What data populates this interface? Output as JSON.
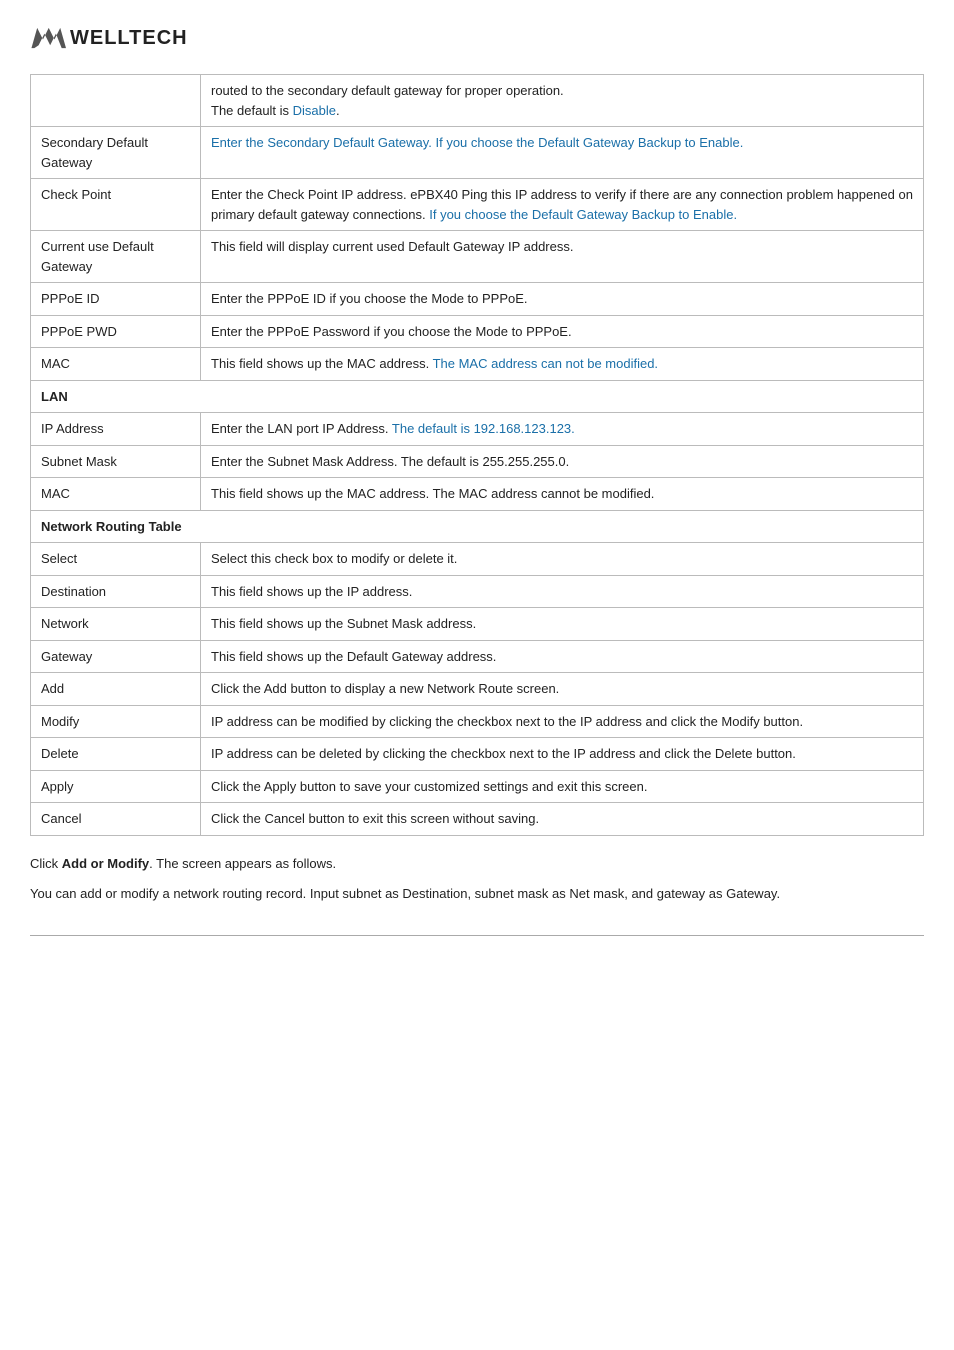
{
  "logo": {
    "text": "WELLTECH"
  },
  "table_rows": [
    {
      "id": "row-routed",
      "col1": "",
      "col2_parts": [
        {
          "text": "routed to the secondary default gateway for proper operation.",
          "blue": false
        },
        {
          "text": " The default is ",
          "blue": false
        },
        {
          "text": "Disable",
          "blue": true
        },
        {
          "text": ".",
          "blue": false
        }
      ]
    },
    {
      "id": "row-secondary-default-gateway",
      "col1": "Secondary Default Gateway",
      "col2_parts": [
        {
          "text": "Enter the Secondary Default Gateway. If you choose the Default Gateway Backup to Enable.",
          "blue": true
        }
      ]
    },
    {
      "id": "row-check-point",
      "col1": "Check Point",
      "col2_parts": [
        {
          "text": "Enter the Check Point IP address. ePBX40 Ping this IP address to verify if there are any connection problem happened on primary default gateway connections. ",
          "blue": false
        },
        {
          "text": "If you choose the Default Gateway Backup to Enable.",
          "blue": true
        }
      ]
    },
    {
      "id": "row-current-default-gateway",
      "col1": "Current use Default Gateway",
      "col2_parts": [
        {
          "text": "This field will display current used Default Gateway IP address.",
          "blue": false
        }
      ]
    },
    {
      "id": "row-pppoe-id",
      "col1": "PPPoE ID",
      "col2_parts": [
        {
          "text": "Enter the PPPoE ID if you choose the Mode to PPPoE.",
          "blue": false
        }
      ]
    },
    {
      "id": "row-pppoe-pwd",
      "col1": "PPPoE PWD",
      "col2_parts": [
        {
          "text": "Enter the PPPoE Password if you choose the Mode to PPPoE.",
          "blue": false
        }
      ]
    },
    {
      "id": "row-mac-wan",
      "col1": "MAC",
      "col2_parts": [
        {
          "text": "This field shows up the MAC address. ",
          "blue": false
        },
        {
          "text": "The MAC address can not be modified.",
          "blue": true
        }
      ]
    },
    {
      "id": "row-lan-header",
      "col1": "LAN",
      "col2": "",
      "is_section": true
    },
    {
      "id": "row-ip-address",
      "col1": "IP Address",
      "col2_parts": [
        {
          "text": "Enter the LAN port IP Address. ",
          "blue": false
        },
        {
          "text": "The default is 192.168.123.123.",
          "blue": true
        }
      ]
    },
    {
      "id": "row-subnet-mask",
      "col1": "Subnet Mask",
      "col2_parts": [
        {
          "text": "Enter the Subnet Mask Address. The default is 255.255.255.0.",
          "blue": false
        }
      ]
    },
    {
      "id": "row-mac-lan",
      "col1": "MAC",
      "col2_parts": [
        {
          "text": "This field shows up the MAC address. The MAC address cannot be modified.",
          "blue": false
        }
      ]
    },
    {
      "id": "row-network-routing-header",
      "col1": "Network Routing Table",
      "col2": "",
      "is_section": true,
      "colspan": true
    },
    {
      "id": "row-select",
      "col1": "Select",
      "col2_parts": [
        {
          "text": "Select this check box to modify or delete it.",
          "blue": false
        }
      ]
    },
    {
      "id": "row-destination",
      "col1": "Destination",
      "col2_parts": [
        {
          "text": "This field shows up the IP address.",
          "blue": false
        }
      ]
    },
    {
      "id": "row-network",
      "col1": "Network",
      "col2_parts": [
        {
          "text": "This field shows up the Subnet Mask address.",
          "blue": false
        }
      ]
    },
    {
      "id": "row-gateway",
      "col1": "Gateway",
      "col2_parts": [
        {
          "text": "This field shows up the Default Gateway address.",
          "blue": false
        }
      ]
    },
    {
      "id": "row-add",
      "col1": "Add",
      "col2_parts": [
        {
          "text": "Click the Add button to display a new Network Route screen.",
          "blue": false
        }
      ]
    },
    {
      "id": "row-modify",
      "col1": "Modify",
      "col2_parts": [
        {
          "text": "IP address can be modified by clicking the checkbox next to the IP address and click the Modify button.",
          "blue": false
        }
      ]
    },
    {
      "id": "row-delete",
      "col1": "Delete",
      "col2_parts": [
        {
          "text": "IP address can be deleted by clicking the checkbox next to the IP address and click the Delete button.",
          "blue": false
        }
      ]
    },
    {
      "id": "row-apply",
      "col1": "Apply",
      "col2_parts": [
        {
          "text": "Click the Apply button to save your customized settings and exit this screen.",
          "blue": false
        }
      ]
    },
    {
      "id": "row-cancel",
      "col1": "Cancel",
      "col2_parts": [
        {
          "text": "Click the Cancel button to exit this screen without saving.",
          "blue": false
        }
      ]
    }
  ],
  "footer_para1": {
    "prefix": "Click ",
    "bold": "Add or Modify",
    "suffix": ". The screen appears as follows."
  },
  "footer_para2": "You can add or modify a network routing record. Input subnet as Destination, subnet mask as Net mask, and gateway as Gateway."
}
